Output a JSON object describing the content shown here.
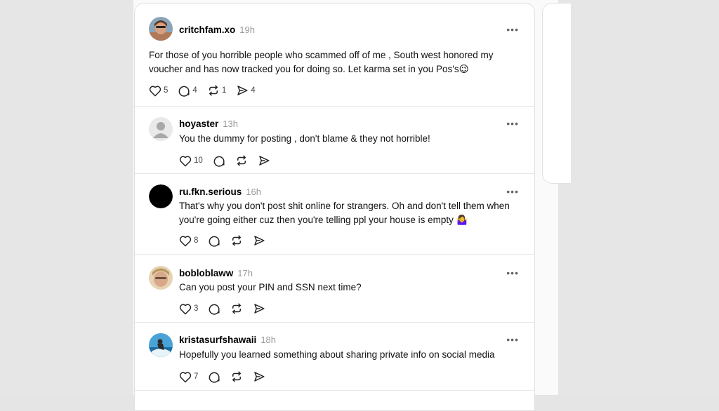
{
  "posts": [
    {
      "username": "critchfam.xo",
      "time": "19h",
      "text_line1": "For those of you horrible people who scammed off of me , South west honored my",
      "text_line2": "voucher and has now tracked you for doing so. Let karma set in you Pos's😉",
      "likes": "5",
      "replies": "4",
      "reposts": "1",
      "shares": "4"
    },
    {
      "username": "hoyaster",
      "time": "13h",
      "text_line1": "You the dummy for posting , don't blame & they not horrible!",
      "likes": "10"
    },
    {
      "username": "ru.fkn.serious",
      "time": "16h",
      "text_line1": "That's why you don't post shit online for strangers. Oh and don't tell them when",
      "text_line2": "you're going either cuz then you're telling ppl your house is empty 🤷‍♀️",
      "likes": "8"
    },
    {
      "username": "bobloblaww",
      "time": "17h",
      "text_line1": "Can you post your PIN and SSN next time?",
      "likes": "3"
    },
    {
      "username": "kristasurfshawaii",
      "time": "18h",
      "text_line1": "Hopefully you learned something about sharing private info on social media",
      "likes": "7"
    }
  ],
  "more_label": "•••",
  "icons": {
    "like": "heart-icon",
    "reply": "comment-icon",
    "repost": "repost-icon",
    "share": "share-icon",
    "more": "more-options-icon"
  }
}
